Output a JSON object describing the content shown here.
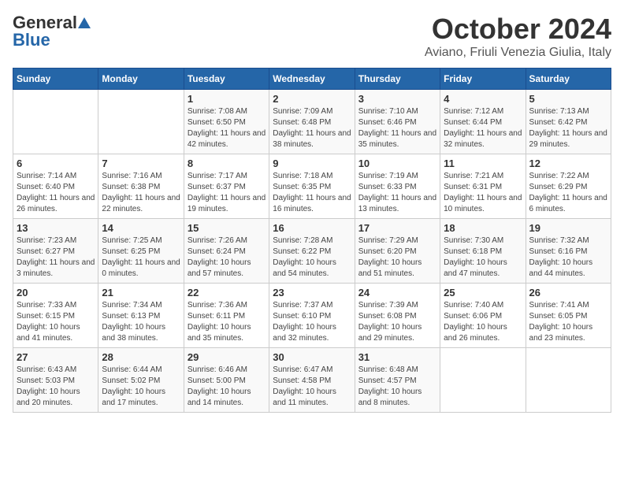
{
  "header": {
    "logo_general": "General",
    "logo_blue": "Blue",
    "month": "October 2024",
    "location": "Aviano, Friuli Venezia Giulia, Italy"
  },
  "days_of_week": [
    "Sunday",
    "Monday",
    "Tuesday",
    "Wednesday",
    "Thursday",
    "Friday",
    "Saturday"
  ],
  "weeks": [
    [
      {
        "day": "",
        "content": ""
      },
      {
        "day": "",
        "content": ""
      },
      {
        "day": "1",
        "content": "Sunrise: 7:08 AM\nSunset: 6:50 PM\nDaylight: 11 hours and 42 minutes."
      },
      {
        "day": "2",
        "content": "Sunrise: 7:09 AM\nSunset: 6:48 PM\nDaylight: 11 hours and 38 minutes."
      },
      {
        "day": "3",
        "content": "Sunrise: 7:10 AM\nSunset: 6:46 PM\nDaylight: 11 hours and 35 minutes."
      },
      {
        "day": "4",
        "content": "Sunrise: 7:12 AM\nSunset: 6:44 PM\nDaylight: 11 hours and 32 minutes."
      },
      {
        "day": "5",
        "content": "Sunrise: 7:13 AM\nSunset: 6:42 PM\nDaylight: 11 hours and 29 minutes."
      }
    ],
    [
      {
        "day": "6",
        "content": "Sunrise: 7:14 AM\nSunset: 6:40 PM\nDaylight: 11 hours and 26 minutes."
      },
      {
        "day": "7",
        "content": "Sunrise: 7:16 AM\nSunset: 6:38 PM\nDaylight: 11 hours and 22 minutes."
      },
      {
        "day": "8",
        "content": "Sunrise: 7:17 AM\nSunset: 6:37 PM\nDaylight: 11 hours and 19 minutes."
      },
      {
        "day": "9",
        "content": "Sunrise: 7:18 AM\nSunset: 6:35 PM\nDaylight: 11 hours and 16 minutes."
      },
      {
        "day": "10",
        "content": "Sunrise: 7:19 AM\nSunset: 6:33 PM\nDaylight: 11 hours and 13 minutes."
      },
      {
        "day": "11",
        "content": "Sunrise: 7:21 AM\nSunset: 6:31 PM\nDaylight: 11 hours and 10 minutes."
      },
      {
        "day": "12",
        "content": "Sunrise: 7:22 AM\nSunset: 6:29 PM\nDaylight: 11 hours and 6 minutes."
      }
    ],
    [
      {
        "day": "13",
        "content": "Sunrise: 7:23 AM\nSunset: 6:27 PM\nDaylight: 11 hours and 3 minutes."
      },
      {
        "day": "14",
        "content": "Sunrise: 7:25 AM\nSunset: 6:25 PM\nDaylight: 11 hours and 0 minutes."
      },
      {
        "day": "15",
        "content": "Sunrise: 7:26 AM\nSunset: 6:24 PM\nDaylight: 10 hours and 57 minutes."
      },
      {
        "day": "16",
        "content": "Sunrise: 7:28 AM\nSunset: 6:22 PM\nDaylight: 10 hours and 54 minutes."
      },
      {
        "day": "17",
        "content": "Sunrise: 7:29 AM\nSunset: 6:20 PM\nDaylight: 10 hours and 51 minutes."
      },
      {
        "day": "18",
        "content": "Sunrise: 7:30 AM\nSunset: 6:18 PM\nDaylight: 10 hours and 47 minutes."
      },
      {
        "day": "19",
        "content": "Sunrise: 7:32 AM\nSunset: 6:16 PM\nDaylight: 10 hours and 44 minutes."
      }
    ],
    [
      {
        "day": "20",
        "content": "Sunrise: 7:33 AM\nSunset: 6:15 PM\nDaylight: 10 hours and 41 minutes."
      },
      {
        "day": "21",
        "content": "Sunrise: 7:34 AM\nSunset: 6:13 PM\nDaylight: 10 hours and 38 minutes."
      },
      {
        "day": "22",
        "content": "Sunrise: 7:36 AM\nSunset: 6:11 PM\nDaylight: 10 hours and 35 minutes."
      },
      {
        "day": "23",
        "content": "Sunrise: 7:37 AM\nSunset: 6:10 PM\nDaylight: 10 hours and 32 minutes."
      },
      {
        "day": "24",
        "content": "Sunrise: 7:39 AM\nSunset: 6:08 PM\nDaylight: 10 hours and 29 minutes."
      },
      {
        "day": "25",
        "content": "Sunrise: 7:40 AM\nSunset: 6:06 PM\nDaylight: 10 hours and 26 minutes."
      },
      {
        "day": "26",
        "content": "Sunrise: 7:41 AM\nSunset: 6:05 PM\nDaylight: 10 hours and 23 minutes."
      }
    ],
    [
      {
        "day": "27",
        "content": "Sunrise: 6:43 AM\nSunset: 5:03 PM\nDaylight: 10 hours and 20 minutes."
      },
      {
        "day": "28",
        "content": "Sunrise: 6:44 AM\nSunset: 5:02 PM\nDaylight: 10 hours and 17 minutes."
      },
      {
        "day": "29",
        "content": "Sunrise: 6:46 AM\nSunset: 5:00 PM\nDaylight: 10 hours and 14 minutes."
      },
      {
        "day": "30",
        "content": "Sunrise: 6:47 AM\nSunset: 4:58 PM\nDaylight: 10 hours and 11 minutes."
      },
      {
        "day": "31",
        "content": "Sunrise: 6:48 AM\nSunset: 4:57 PM\nDaylight: 10 hours and 8 minutes."
      },
      {
        "day": "",
        "content": ""
      },
      {
        "day": "",
        "content": ""
      }
    ]
  ]
}
